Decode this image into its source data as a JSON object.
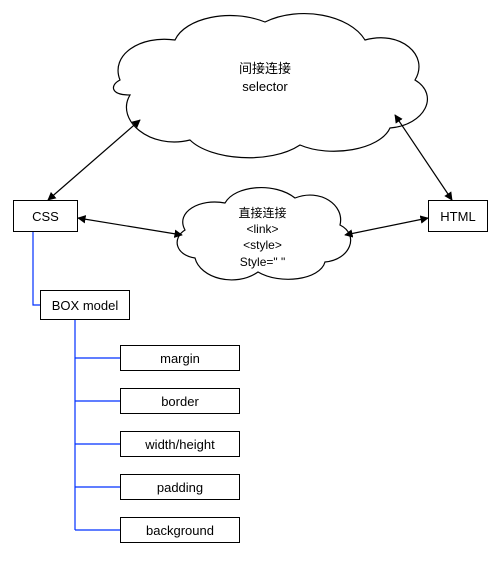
{
  "cloud_top": {
    "line1": "间接连接",
    "line2": "selector"
  },
  "cloud_mid": {
    "line1": "直接连接",
    "line2": "<link>",
    "line3": "<style>",
    "line4": "Style=\" \""
  },
  "css_box": "CSS",
  "html_box": "HTML",
  "box_model": "BOX model",
  "items": {
    "margin": "margin",
    "border": "border",
    "wh": "width/height",
    "padding": "padding",
    "background": "background"
  }
}
